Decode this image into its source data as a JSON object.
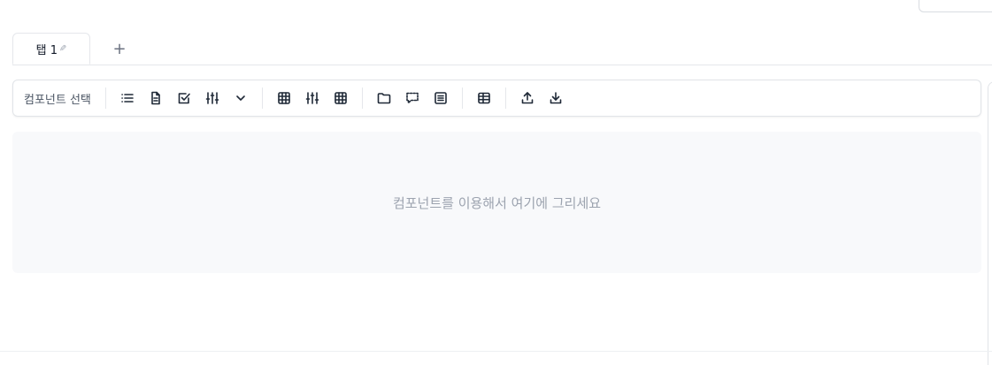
{
  "tabs": [
    {
      "label": "탭 1",
      "edit_icon": "pencil-icon"
    }
  ],
  "add_tab_label": "+",
  "toolbar": {
    "label": "컴포넌트 선택",
    "groups": [
      [
        "list-icon",
        "document-icon",
        "checkbox-icon",
        "sliders-icon",
        "chevron-down-icon"
      ],
      [
        "grid-icon",
        "sliders-icon",
        "grid-icon"
      ],
      [
        "folder-icon",
        "comment-icon",
        "text-lines-icon"
      ],
      [
        "table-icon"
      ],
      [
        "upload-icon",
        "download-icon"
      ]
    ]
  },
  "canvas": {
    "placeholder": "컴포넌트를 이용해서 여기에 그리세요"
  }
}
